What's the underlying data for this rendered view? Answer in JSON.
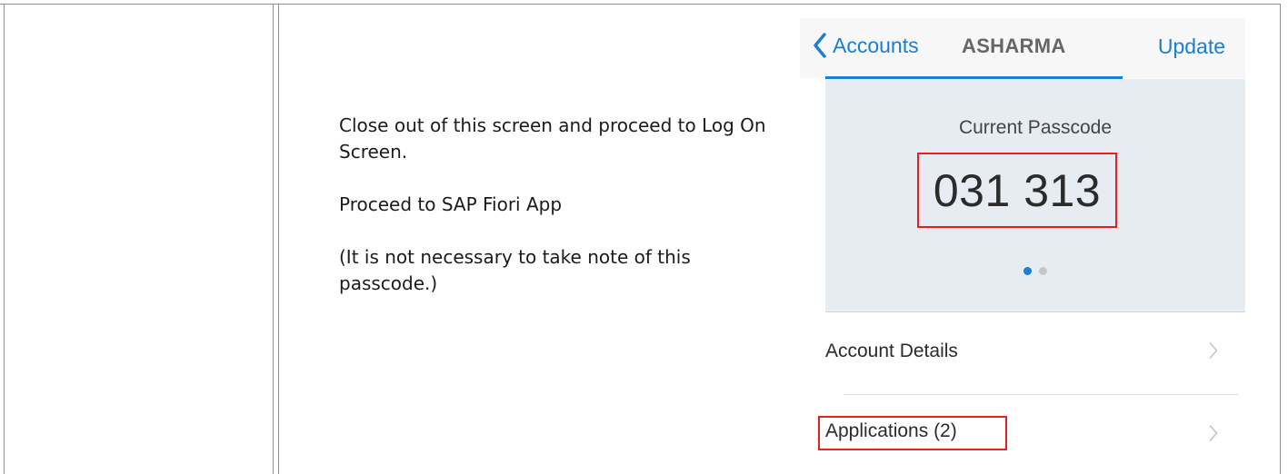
{
  "instructions": {
    "line1": "Close out of this screen and proceed to Log On Screen.",
    "line2": "Proceed to SAP Fiori App",
    "line3": "(It is not necessary to take note of this passcode.)"
  },
  "phone": {
    "nav": {
      "back_label": "Accounts",
      "title": "ASHARMA",
      "update_label": "Update",
      "accent_color": "#1a7fd0"
    },
    "passcode": {
      "caption": "Current Passcode",
      "value": "031 313",
      "page_count": 2,
      "active_page": 1
    },
    "list": [
      {
        "label": "Account Details",
        "icon": "chevron-right-icon"
      },
      {
        "label": "Applications (2)",
        "icon": "chevron-right-icon"
      }
    ],
    "highlight_color": "#e8201b"
  }
}
